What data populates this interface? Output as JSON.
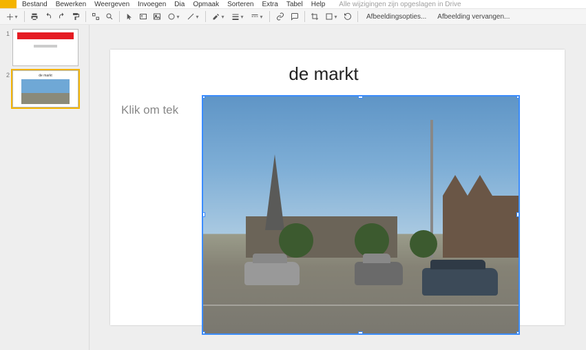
{
  "menus": {
    "file": "Bestand",
    "edit": "Bewerken",
    "view": "Weergeven",
    "insert": "Invoegen",
    "slide": "Dia",
    "format": "Opmaak",
    "arrange": "Sorteren",
    "extra": "Extra",
    "table": "Tabel",
    "help": "Help"
  },
  "save_status": "Alle wijzigingen zijn opgeslagen in Drive",
  "toolbar": {
    "image_options": "Afbeeldingsopties...",
    "replace_image": "Afbeelding vervangen..."
  },
  "thumbnails": [
    {
      "num": "1"
    },
    {
      "num": "2",
      "title": "de markt"
    }
  ],
  "slide": {
    "title": "de markt",
    "body_placeholder": "Klik om tek"
  }
}
